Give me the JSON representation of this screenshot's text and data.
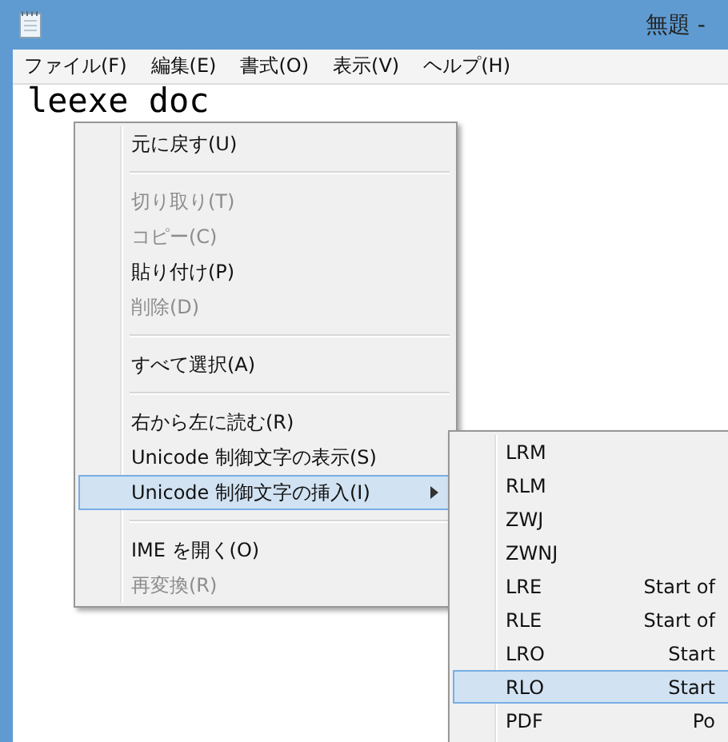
{
  "window": {
    "title": "無題 -"
  },
  "menu_bar": [
    {
      "label": "ファイル(F)"
    },
    {
      "label": "編集(E)"
    },
    {
      "label": "書式(O)"
    },
    {
      "label": "表示(V)"
    },
    {
      "label": "ヘルプ(H)"
    }
  ],
  "editor": {
    "value": "leexe doc"
  },
  "context_menu": {
    "items": [
      {
        "kind": "item",
        "label": "元に戻す(U)",
        "disabled": false,
        "selected": false
      },
      {
        "kind": "separator"
      },
      {
        "kind": "item",
        "label": "切り取り(T)",
        "disabled": true,
        "selected": false
      },
      {
        "kind": "item",
        "label": "コピー(C)",
        "disabled": true,
        "selected": false
      },
      {
        "kind": "item",
        "label": "貼り付け(P)",
        "disabled": false,
        "selected": false
      },
      {
        "kind": "item",
        "label": "削除(D)",
        "disabled": true,
        "selected": false
      },
      {
        "kind": "separator"
      },
      {
        "kind": "item",
        "label": "すべて選択(A)",
        "disabled": false,
        "selected": false
      },
      {
        "kind": "separator"
      },
      {
        "kind": "item",
        "label": "右から左に読む(R)",
        "disabled": false,
        "selected": false
      },
      {
        "kind": "item",
        "label": "Unicode 制御文字の表示(S)",
        "disabled": false,
        "selected": false
      },
      {
        "kind": "submenu",
        "label": "Unicode 制御文字の挿入(I)",
        "disabled": false,
        "selected": true
      },
      {
        "kind": "separator"
      },
      {
        "kind": "item",
        "label": "IME を開く(O)",
        "disabled": false,
        "selected": false
      },
      {
        "kind": "item",
        "label": "再変換(R)",
        "disabled": true,
        "selected": false
      }
    ]
  },
  "submenu": {
    "items": [
      {
        "label": "LRM",
        "selected": false
      },
      {
        "label": "RLM",
        "selected": false
      },
      {
        "label": "ZWJ",
        "selected": false
      },
      {
        "label": "ZWNJ",
        "selected": false
      },
      {
        "label": "LRE",
        "description": "Start of",
        "selected": false
      },
      {
        "label": "RLE",
        "description": "Start of",
        "selected": false
      },
      {
        "label": "LRO",
        "description": "Start",
        "selected": false
      },
      {
        "label": "RLO",
        "description": "Start",
        "selected": true
      },
      {
        "label": "PDF",
        "description": "Po",
        "selected": false
      }
    ]
  }
}
